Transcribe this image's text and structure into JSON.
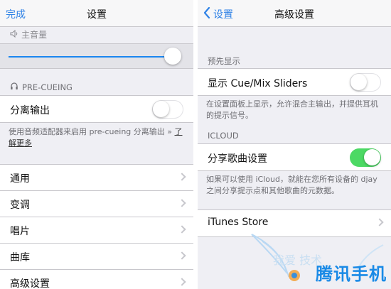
{
  "left": {
    "nav": {
      "done": "完成",
      "title": "设置"
    },
    "volume": {
      "label": "主音量",
      "level": 0.98
    },
    "precue": {
      "header": "PRE-CUEING",
      "split_label": "分离输出",
      "split_on": false,
      "footer_text": "使用音频适配器来启用 pre-cueing 分离输出 » ",
      "footer_link": "了解更多"
    },
    "menu": [
      {
        "label": "通用"
      },
      {
        "label": "变调"
      },
      {
        "label": "唱片"
      },
      {
        "label": "曲库"
      },
      {
        "label": "高级设置"
      }
    ]
  },
  "right": {
    "nav": {
      "back": "设置",
      "title": "高级设置"
    },
    "preview": {
      "header": "预先显示",
      "label": "显示 Cue/Mix Sliders",
      "on": false,
      "footer": "在设置面板上显示，允许混合主输出，并提供耳机的提示信号。"
    },
    "icloud": {
      "header": "ICLOUD",
      "label": "分享歌曲设置",
      "on": true,
      "footer": "如果可以使用 iCloud，就能在您所有设备的 djay 之间分享提示点和其他歌曲的元数据。"
    },
    "store": {
      "label": "iTunes Store"
    }
  },
  "watermark": {
    "text": "腾讯手机",
    "faint_text": "我爱    技术 "
  },
  "colors": {
    "accent": "#2f82e6",
    "toggle_on": "#4cd964",
    "background": "#efeff4"
  }
}
